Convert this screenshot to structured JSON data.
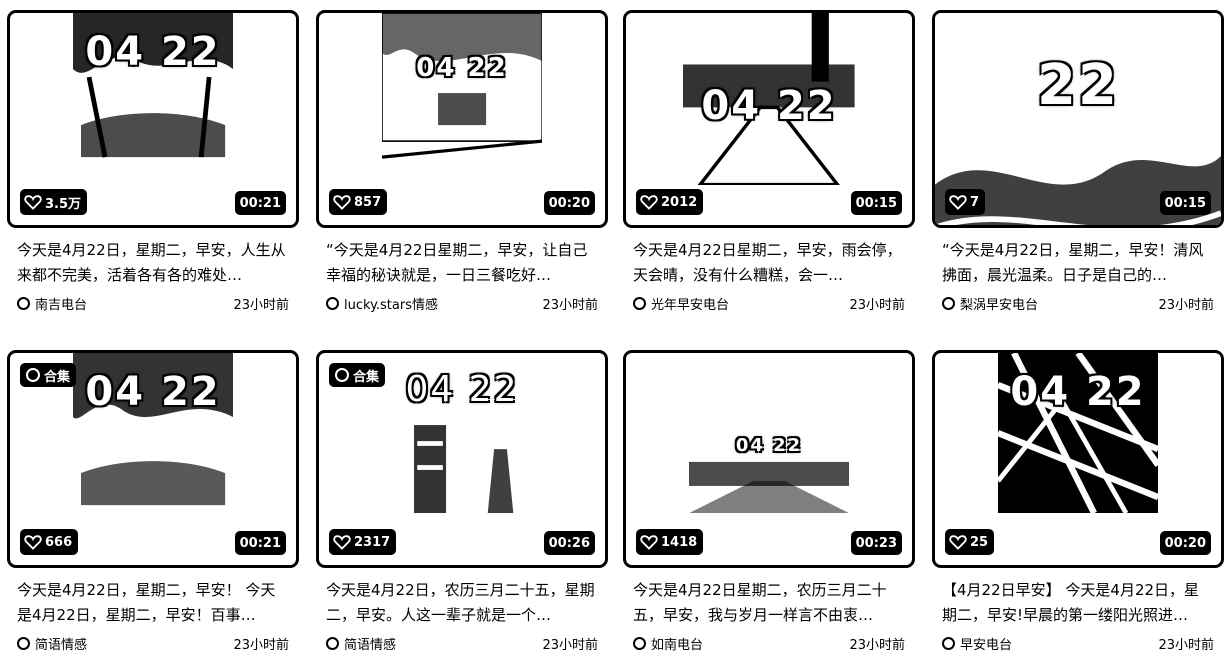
{
  "cards": [
    {
      "stamp": "04 22",
      "likes": "3.5万",
      "duration": "00:21",
      "collection": "",
      "title": "今天是4月22日，星期二，早安，人生从来都不完美，活着各有各的难处…",
      "author": "南吉电台",
      "time": "23小时前"
    },
    {
      "stamp": "04 22",
      "likes": "857",
      "duration": "00:20",
      "collection": "",
      "title": "“今天是4月22日星期二，早安，让自己幸福的秘诀就是，一日三餐吃好…",
      "author": "lucky.stars情感",
      "time": "23小时前"
    },
    {
      "stamp": "04 22",
      "likes": "2012",
      "duration": "00:15",
      "collection": "",
      "title": "今天是4月22日星期二，早安，雨会停，天会晴，没有什么糟糕，会一…",
      "author": "光年早安电台",
      "time": "23小时前"
    },
    {
      "stamp": "22",
      "likes": "7",
      "duration": "00:15",
      "collection": "",
      "title": "“今天是4月22日，星期二，早安！清风拂面，晨光温柔。日子是自己的…",
      "author": "梨涡早安电台",
      "time": "23小时前"
    },
    {
      "stamp": "04 22",
      "likes": "666",
      "duration": "00:21",
      "collection": "合集",
      "title": "今天是4月22日，星期二，早安！ 今天是4月22日，星期二，早安！百事…",
      "author": "简语情感",
      "time": "23小时前"
    },
    {
      "stamp": "04 22",
      "likes": "2317",
      "duration": "00:26",
      "collection": "合集",
      "title": "今天是4月22日，农历三月二十五，星期二，早安。人这一辈子就是一个…",
      "author": "简语情感",
      "time": "23小时前"
    },
    {
      "stamp": "04 22",
      "likes": "1418",
      "duration": "00:23",
      "collection": "",
      "title": "今天是4月22日星期二，农历三月二十五，早安，我与岁月一样言不由衷…",
      "author": "如南电台",
      "time": "23小时前"
    },
    {
      "stamp": "04 22",
      "likes": "25",
      "duration": "00:20",
      "collection": "",
      "title": "【4月22日早安】 今天是4月22日，星期二，早安!早晨的第一缕阳光照进…",
      "author": "早安电台",
      "time": "23小时前"
    }
  ],
  "icons": {
    "like": "heart-icon",
    "author": "author-icon",
    "collection": "collection-icon"
  }
}
